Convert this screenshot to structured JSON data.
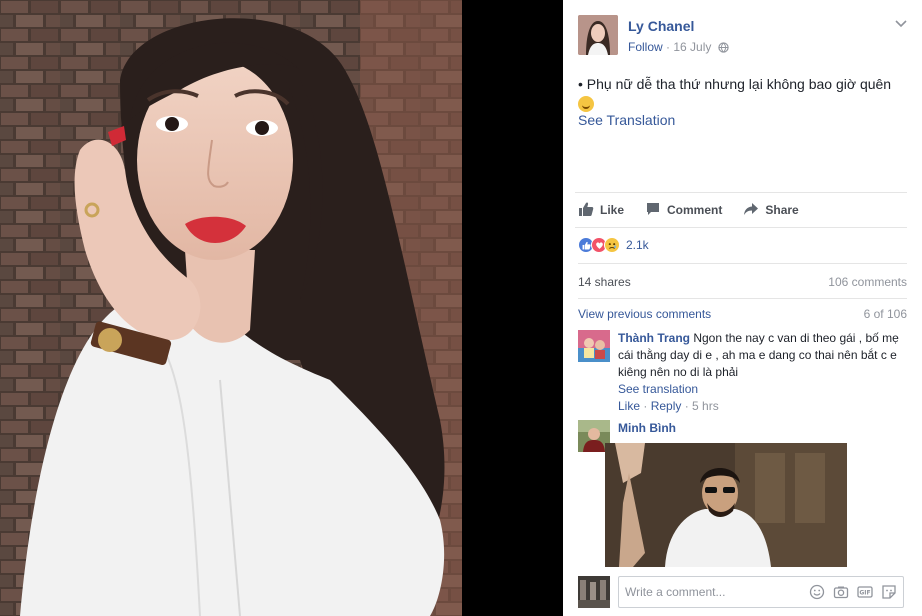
{
  "post": {
    "author": "Ly Chanel",
    "follow": "Follow",
    "sep": " · ",
    "date": "16 July",
    "text": "• Phụ nữ dễ tha thứ nhưng lại không bao giờ quên",
    "see_translation": "See Translation",
    "menu_icon": "chevron-down-icon",
    "audience_icon": "globe-icon"
  },
  "actions": {
    "like": "Like",
    "comment": "Comment",
    "share": "Share"
  },
  "reactions": {
    "types": [
      "like",
      "love",
      "sad"
    ],
    "count": "2.1k"
  },
  "stats": {
    "shares": "14 shares",
    "comments": "106 comments"
  },
  "comments_header": {
    "view_previous": "View previous comments",
    "position": "6 of 106"
  },
  "comments": [
    {
      "name": "Thành Trang",
      "text": "Ngon the nay c van di theo gái , bố mẹ cái thằng day di e , ah ma e dang co thai nên bắt c e kiêng nên no di là phải",
      "see_translation": "See translation",
      "like": "Like",
      "dot": " · ",
      "reply": "Reply",
      "time": " · 5 hrs"
    },
    {
      "name": "Minh Bình"
    }
  ],
  "composer": {
    "placeholder": "Write a comment...",
    "icons": [
      "emoji-icon",
      "camera-icon",
      "gif-icon",
      "sticker-icon"
    ]
  },
  "colors": {
    "link": "#365899",
    "muted": "#90949c",
    "text": "#1d2129",
    "border": "#e5e5e5"
  }
}
